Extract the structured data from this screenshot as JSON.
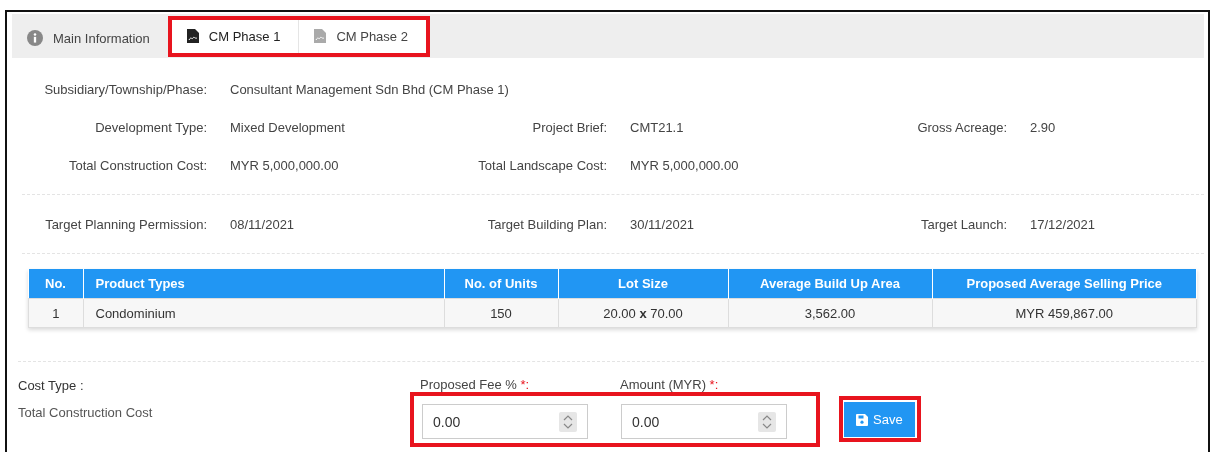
{
  "tabs": [
    {
      "label": "Main Information",
      "kind": "info",
      "selected": false,
      "highlighted": false
    },
    {
      "label": "CM Phase 1",
      "kind": "document",
      "selected": true,
      "highlighted": true
    },
    {
      "label": "CM Phase 2",
      "kind": "document",
      "selected": false,
      "highlighted": true
    }
  ],
  "info_sections": [
    [
      [
        {
          "label": "Subsidiary/Township/Phase:",
          "value": "Consultant Management Sdn Bhd (CM Phase 1)"
        }
      ],
      [
        {
          "label": "Development Type:",
          "value": "Mixed Development"
        },
        {
          "label": "Project Brief:",
          "value": "CMT21.1"
        },
        {
          "label": "Gross Acreage:",
          "value": "2.90"
        }
      ],
      [
        {
          "label": "Total Construction Cost:",
          "value": "MYR 5,000,000.00"
        },
        {
          "label": "Total Landscape Cost:",
          "value": "MYR 5,000,000.00"
        }
      ]
    ],
    [
      [
        {
          "label": "Target Planning Permission:",
          "value": "08/11/2021"
        },
        {
          "label": "Target Building Plan:",
          "value": "30/11/2021"
        },
        {
          "label": "Target Launch:",
          "value": "17/12/2021"
        }
      ]
    ]
  ],
  "table": {
    "columns": [
      "No.",
      "Product Types",
      "No. of Units",
      "Lot Size",
      "Average Build Up Area",
      "Proposed Average Selling Price"
    ],
    "rows": [
      [
        "1",
        "Condominium",
        "150",
        "20.00 **x** 70.00",
        "3,562.00",
        "MYR 459,867.00"
      ]
    ]
  },
  "cost": {
    "label": "Cost Type :",
    "value": "Total Construction Cost"
  },
  "fields": [
    {
      "label": "Proposed Fee %",
      "required_mark": "*:",
      "value": "0.00"
    },
    {
      "label": "Amount (MYR)",
      "required_mark": "*:",
      "value": "0.00"
    }
  ],
  "save_button": {
    "label": "Save"
  }
}
